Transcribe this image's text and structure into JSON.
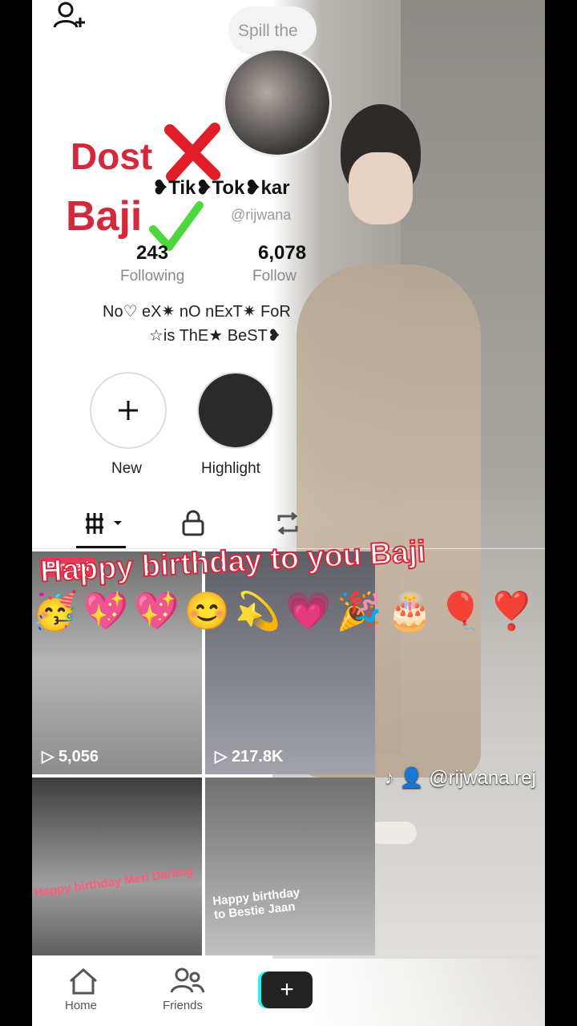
{
  "header": {
    "spill_placeholder": "Spill the"
  },
  "profile": {
    "nickname": "❥Tik❥Tok❥kar",
    "handle": "@rijwana",
    "following_count": "243",
    "following_label": "Following",
    "followers_count": "6,078",
    "followers_label": "Follow",
    "bio_line1": "No♡ eX✷ nO nExT✷ FoR",
    "bio_line2": "☆is ThE★ BeST❥"
  },
  "overlay": {
    "line1": "Dost",
    "line2": "Baji"
  },
  "highlights": [
    {
      "label": "New"
    },
    {
      "label": "Highlight"
    }
  ],
  "videos": [
    {
      "pinned": "Pinned",
      "views": "5,056"
    },
    {
      "views": "217.8K"
    },
    {
      "caption": "Happy birthday Meri Darling"
    },
    {
      "caption": "Happy birthday to Bestie Jaan"
    }
  ],
  "caption": {
    "text": "Happy birthday to you Baji",
    "emojis": "🥳💖💖😊💫💗🎉🎂🎈❣️"
  },
  "watermark": "@rijwana.rej",
  "nav": {
    "home": "Home",
    "friends": "Friends"
  }
}
